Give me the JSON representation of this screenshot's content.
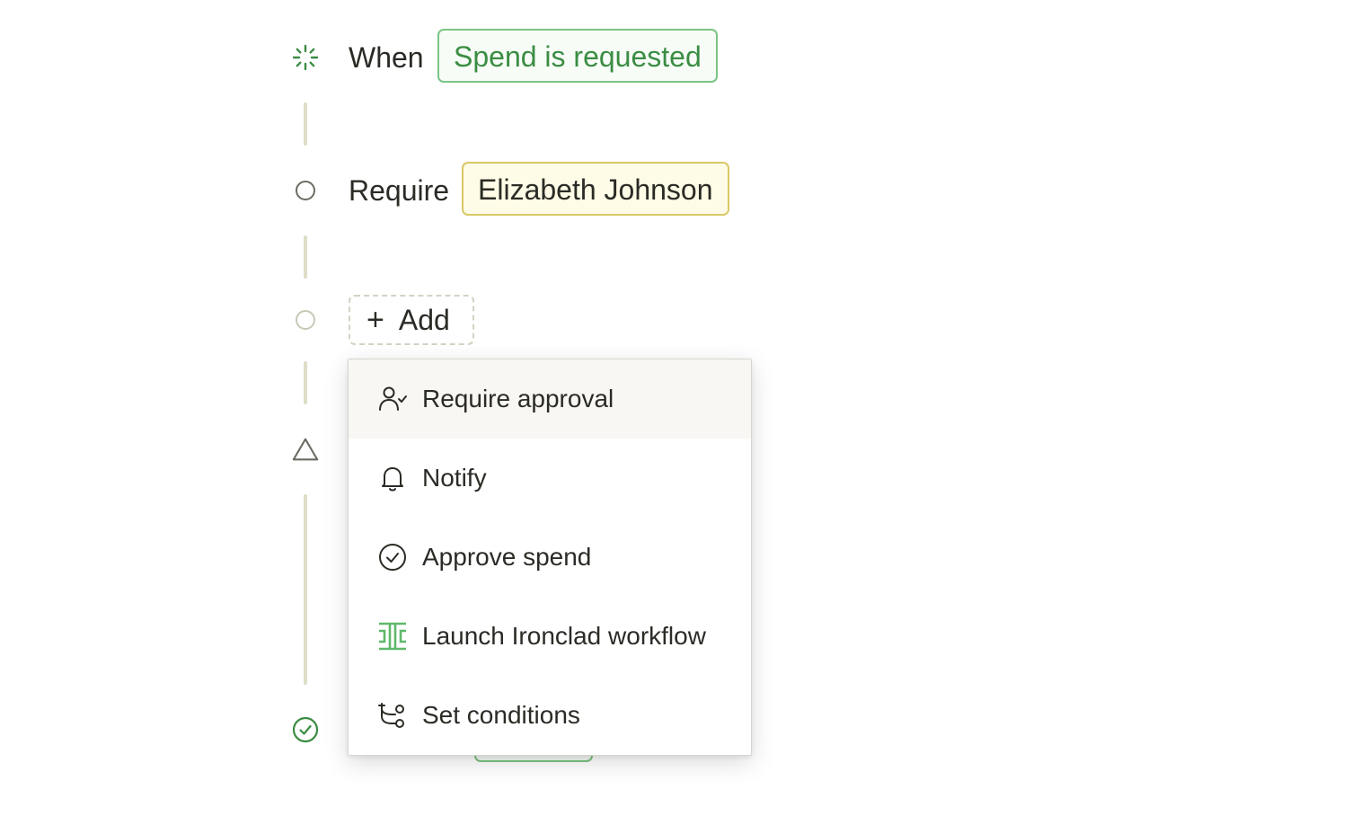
{
  "workflow": {
    "trigger": {
      "label": "When",
      "value": "Spend is requested",
      "icon": "spinner-icon",
      "accent_color": "#3b8d43"
    },
    "approval_step": {
      "label": "Require",
      "value": "Elizabeth Johnson",
      "icon": "circle-icon",
      "chip_color": "#fefce6"
    },
    "add_step": {
      "label": "Add",
      "icon": "plus-icon",
      "node_icon": "circle-icon"
    },
    "warning_node": {
      "icon": "triangle-icon"
    },
    "end_node": {
      "icon": "check-circle-icon",
      "color": "#3b8d43"
    }
  },
  "add_menu": {
    "items": [
      {
        "label": "Require approval",
        "icon": "user-check-icon",
        "highlighted": true
      },
      {
        "label": "Notify",
        "icon": "bell-icon"
      },
      {
        "label": "Approve spend",
        "icon": "check-circle-icon"
      },
      {
        "label": "Launch Ironclad workflow",
        "icon": "ironclad-icon",
        "icon_color": "#5fb86a"
      },
      {
        "label": "Set conditions",
        "icon": "branch-icon"
      }
    ]
  }
}
